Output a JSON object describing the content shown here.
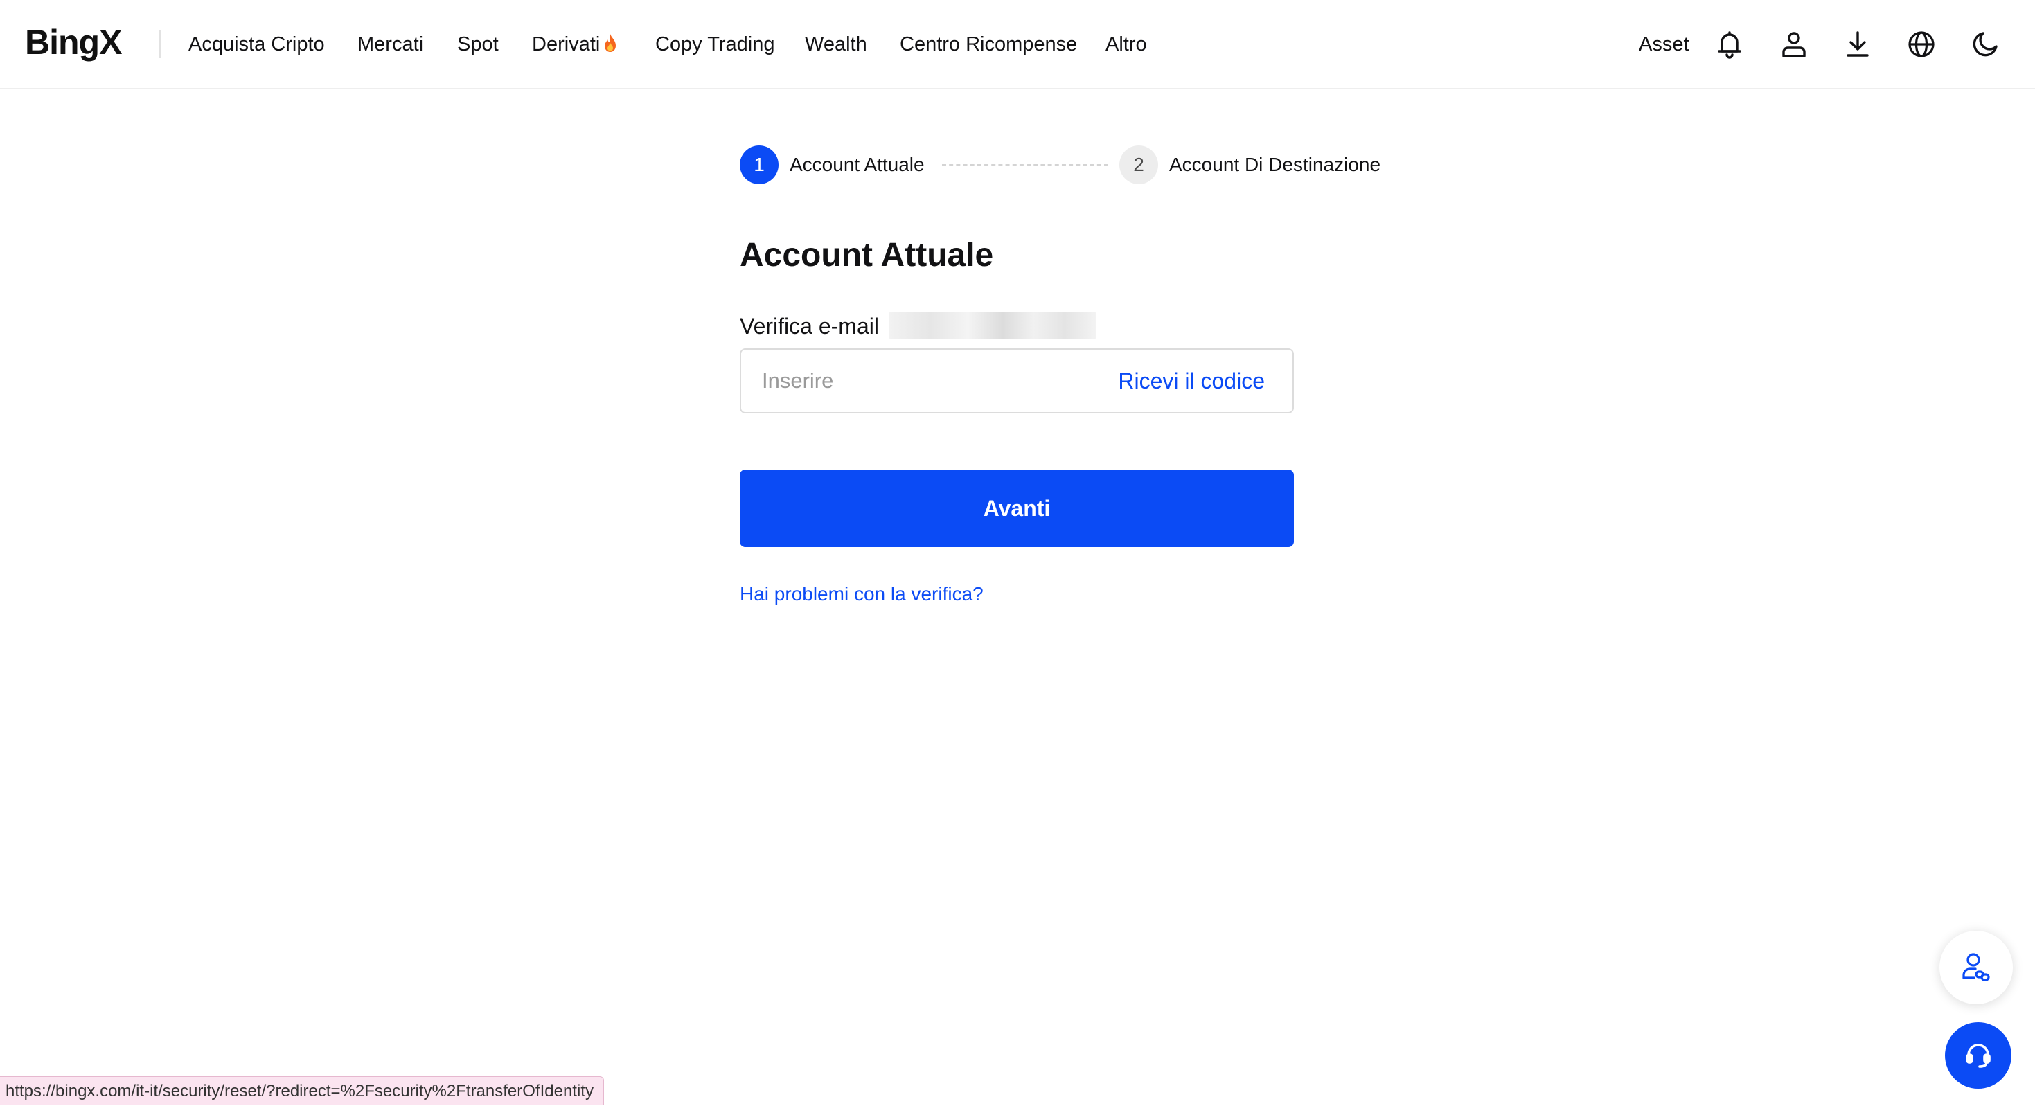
{
  "brand": {
    "logo_text": "BingX"
  },
  "nav": {
    "items": [
      {
        "label": "Acquista Cripto"
      },
      {
        "label": "Mercati"
      },
      {
        "label": "Spot"
      },
      {
        "label": "Derivati"
      },
      {
        "label": "Copy Trading"
      },
      {
        "label": "Wealth"
      },
      {
        "label": "Centro Ricompense"
      },
      {
        "label": "Altro"
      }
    ],
    "derivati_badge_icon": "fire-icon"
  },
  "toolbar": {
    "asset_label": "Asset",
    "icons": [
      "bell-icon",
      "user-icon",
      "download-icon",
      "globe-icon",
      "moon-icon"
    ]
  },
  "stepper": {
    "steps": [
      {
        "number": "1",
        "label": "Account Attuale",
        "state": "active"
      },
      {
        "number": "2",
        "label": "Account Di Destinazione",
        "state": "inactive"
      }
    ]
  },
  "form": {
    "title": "Account Attuale",
    "email_label": "Verifica e-mail",
    "code_input": {
      "placeholder": "Inserire",
      "value": ""
    },
    "get_code_label": "Ricevi il codice",
    "submit_label": "Avanti",
    "help_link": "Hai problemi con la verifica?"
  },
  "floating": {
    "community_icon": "user-link-icon",
    "support_icon": "headset-icon"
  },
  "status_bar": {
    "url": "https://bingx.com/it-it/security/reset/?redirect=%2Fsecurity%2FtransferOfIdentity"
  },
  "colors": {
    "accent": "#0b4bf5",
    "text": "#121214",
    "border": "#dcdcdc",
    "step_inactive_bg": "#ededed"
  }
}
